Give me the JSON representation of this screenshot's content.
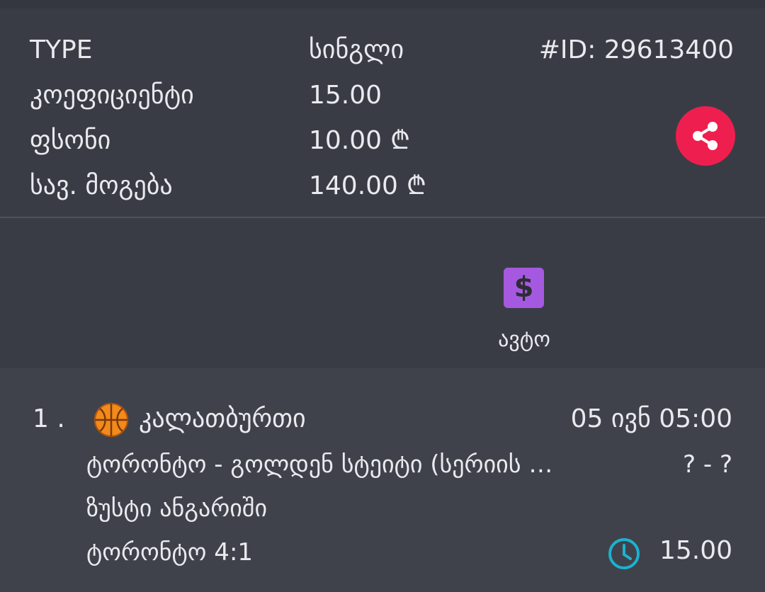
{
  "ticket": {
    "id_text": "#ID: 29613400",
    "rows": [
      {
        "label": "TYPE",
        "value": "სინგლი",
        "currency": ""
      },
      {
        "label": "კოეფიციენტი",
        "value": "15.00",
        "currency": ""
      },
      {
        "label": "ფსონი",
        "value": "10.00",
        "currency": "₾"
      },
      {
        "label": "სავ. მოგება",
        "value": "140.00",
        "currency": "₾"
      }
    ],
    "share_icon": "share-icon",
    "share_color": "#ee1f4f"
  },
  "auto": {
    "icon": "dollar-icon",
    "icon_symbol": "$",
    "icon_color": "#a559e0",
    "label": "ავტო"
  },
  "bet": {
    "index": "1 .",
    "sport_icon": "basketball-icon",
    "sport": "კალათბურთი",
    "datetime": "05 ივნ 05:00",
    "match": "ტორონტო - გოლდენ სტეიტი (სერიის …",
    "score": "? - ?",
    "market": "ზუსტი ანგარიში",
    "pick": "ტორონტო 4:1",
    "status_icon": "clock-icon",
    "odd": "15.00"
  }
}
